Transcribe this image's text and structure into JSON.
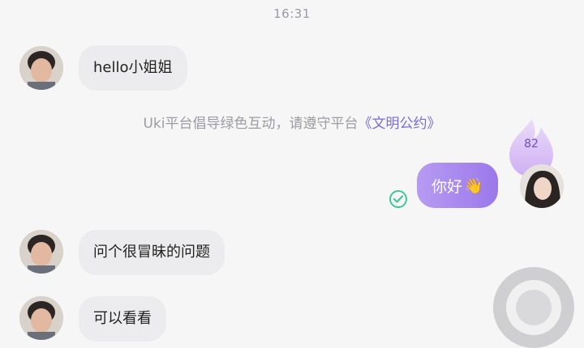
{
  "status": {
    "time": "16:31"
  },
  "messages": [
    {
      "side": "in",
      "text": "hello小姐姐"
    },
    {
      "side": "out",
      "text": "你好",
      "emoji": "👋"
    },
    {
      "side": "in",
      "text": "问个很冒昧的问题"
    },
    {
      "side": "in",
      "text": "可以看看"
    }
  ],
  "notice": {
    "text": "Uki平台倡导绿色互动，请遵守平台",
    "link": "《文明公约》"
  },
  "intimacy": {
    "score": "82"
  },
  "colors": {
    "outgoing_bubble_start": "#b79bf2",
    "outgoing_bubble_end": "#9b78ea",
    "read_check": "#3fc79a",
    "notice_link": "#7c6bd6"
  },
  "icons": {
    "read_status": "check-circle-icon",
    "intimacy": "flame-icon",
    "floating": "floating-ball-icon"
  }
}
